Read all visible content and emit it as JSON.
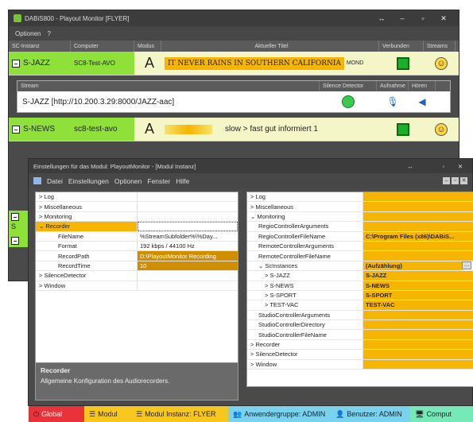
{
  "main_window": {
    "title": "DABiS800 - Playout Monitor [FLYER]",
    "menu": [
      "Optionen",
      "?"
    ],
    "columns": [
      "SC-Instanz",
      "Computer",
      "Modus",
      "Aktueller Titel",
      "Verbunden",
      "Streams"
    ],
    "instances": [
      {
        "name": "S-JAZZ",
        "computer": "SC8-Test-AVO",
        "mode": "A",
        "title": "IT NEVER RAINS IN SOUTHERN CALIFORNIA",
        "title_suffix": "MOND"
      },
      {
        "name": "S-NEWS",
        "computer": "sc8-test-avo",
        "mode": "A",
        "title": "slow > fast gut informiert 1",
        "title_suffix": ""
      }
    ],
    "stream_panel": {
      "columns": [
        "Stream",
        "Silence Detector",
        "Aufnahme",
        "Hören"
      ],
      "stream": "S-JAZZ [http://10.200.3.29:8000/JAZZ-aac]"
    },
    "partial_rows": [
      "S"
    ]
  },
  "settings_window": {
    "title": "Einstellungen für das Modul: PlayoutMonitor - [Modul Instanz]",
    "menu": [
      "Datei",
      "Einstellungen",
      "Optionen",
      "Fenster",
      "Hilfe"
    ],
    "left_grid": [
      {
        "key": "> Log",
        "value": ""
      },
      {
        "key": "> Miscellaneous",
        "value": ""
      },
      {
        "key": "> Monitoring",
        "value": ""
      },
      {
        "key": "⌄ Recorder",
        "value": ""
      },
      {
        "key": "FileName",
        "value": "%StreamSubfolder%\\%Day..."
      },
      {
        "key": "Format",
        "value": "192 kbps / 44100 Hz"
      },
      {
        "key": "RecordPath",
        "value": "D:\\PlayoutMonitor Recording"
      },
      {
        "key": "RecordTime",
        "value": "10"
      },
      {
        "key": "> SilenceDetector",
        "value": ""
      },
      {
        "key": "> Window",
        "value": ""
      }
    ],
    "description": {
      "title": "Recorder",
      "text": "Allgemeine Konfiguration des Audiorecorders."
    },
    "right_grid": [
      {
        "key": "> Log",
        "value": ""
      },
      {
        "key": "> Miscellaneous",
        "value": ""
      },
      {
        "key": "⌄ Monitoring",
        "value": ""
      },
      {
        "key": "RegioControllerArguments",
        "value": ""
      },
      {
        "key": "RegioControllerFileName",
        "value": "C:\\Program Files (x86)\\DABiS..."
      },
      {
        "key": "RemoteControllerArguments",
        "value": ""
      },
      {
        "key": "RemoteControllerFileName",
        "value": ""
      },
      {
        "key": "⌄ ScInstances",
        "value": "(Aufzählung)"
      },
      {
        "key": "> S-JAZZ",
        "value": "S-JAZZ"
      },
      {
        "key": "> S-NEWS",
        "value": "S-NEWS"
      },
      {
        "key": "> S-SPORT",
        "value": "S-SPORT"
      },
      {
        "key": "> TEST-VAC",
        "value": "TEST-VAC"
      },
      {
        "key": "StudioControllerArguments",
        "value": ""
      },
      {
        "key": "StudioControllerDirectory",
        "value": ""
      },
      {
        "key": "StudioControllerFileName",
        "value": ""
      },
      {
        "key": "> Recorder",
        "value": ""
      },
      {
        "key": "> SilenceDetector",
        "value": ""
      },
      {
        "key": "> Window",
        "value": ""
      }
    ]
  },
  "status_bar": [
    {
      "label": "Global",
      "color": "#e8333a"
    },
    {
      "label": "Modul",
      "color": "#f7c71e"
    },
    {
      "label": "Modul Instanz: FLYER",
      "color": "#f7c71e"
    },
    {
      "label": "Anwendergruppe: ADMIN",
      "color": "#7ad3ee"
    },
    {
      "label": "Benutzer: ADMIN",
      "color": "#7ad3ee"
    },
    {
      "label": "Comput",
      "color": "#77e8b8"
    }
  ]
}
